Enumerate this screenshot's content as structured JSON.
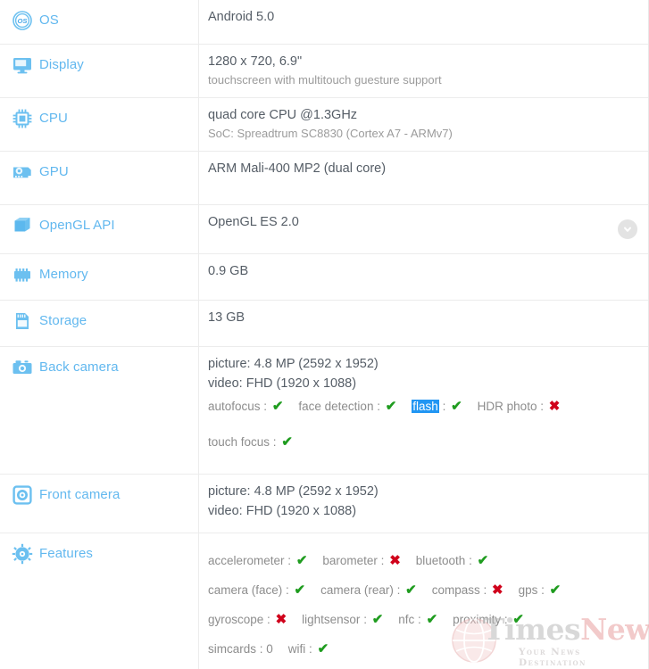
{
  "accent_color": "#62b8ef",
  "yes_color": "#1f9c1f",
  "no_color": "#d0021b",
  "highlight_color": "#2196f3",
  "symbols": {
    "yes": "✔",
    "no": "✖"
  },
  "rows": [
    {
      "key": "os",
      "icon": "os-icon",
      "label": "OS",
      "primary": "Android 5.0",
      "secondary": ""
    },
    {
      "key": "display",
      "icon": "display-icon",
      "label": "Display",
      "primary": "1280 x 720, 6.9\"",
      "secondary": "touchscreen with multitouch guesture support"
    },
    {
      "key": "cpu",
      "icon": "cpu-icon",
      "label": "CPU",
      "primary": "quad core CPU @1.3GHz",
      "secondary": "SoC: Spreadtrum SC8830 (Cortex A7 - ARMv7)"
    },
    {
      "key": "gpu",
      "icon": "gpu-icon",
      "label": "GPU",
      "primary": "ARM Mali-400 MP2 (dual core)",
      "secondary": ""
    },
    {
      "key": "opengl",
      "icon": "opengl-icon",
      "label": "OpenGL API",
      "primary": "OpenGL ES 2.0",
      "secondary": "",
      "expandable": true
    },
    {
      "key": "memory",
      "icon": "memory-icon",
      "label": "Memory",
      "primary": "0.9 GB",
      "secondary": ""
    },
    {
      "key": "storage",
      "icon": "storage-icon",
      "label": "Storage",
      "primary": "13 GB",
      "secondary": ""
    }
  ],
  "back_camera": {
    "icon": "back-camera-icon",
    "label": "Back camera",
    "picture": "picture: 4.8 MP (2592 x 1952)",
    "video": "video: FHD (1920 x 1088)",
    "features_line1": [
      {
        "name": "autofocus",
        "value": "yes",
        "highlighted": false
      },
      {
        "name": "face detection",
        "value": "yes",
        "highlighted": false
      },
      {
        "name": "flash",
        "value": "yes",
        "highlighted": true
      },
      {
        "name": "HDR photo",
        "value": "no",
        "highlighted": false
      }
    ],
    "features_line2": [
      {
        "name": "touch focus",
        "value": "yes",
        "highlighted": false
      }
    ]
  },
  "front_camera": {
    "icon": "front-camera-icon",
    "label": "Front camera",
    "picture": "picture: 4.8 MP (2592 x 1952)",
    "video": "video: FHD (1920 x 1088)"
  },
  "features": {
    "icon": "features-icon",
    "label": "Features",
    "lines": [
      [
        {
          "name": "accelerometer",
          "value": "yes"
        },
        {
          "name": "barometer",
          "value": "no"
        },
        {
          "name": "bluetooth",
          "value": "yes"
        }
      ],
      [
        {
          "name": "camera (face)",
          "value": "yes"
        },
        {
          "name": "camera (rear)",
          "value": "yes"
        },
        {
          "name": "compass",
          "value": "no"
        },
        {
          "name": "gps",
          "value": "yes"
        }
      ],
      [
        {
          "name": "gyroscope",
          "value": "no"
        },
        {
          "name": "lightsensor",
          "value": "yes"
        },
        {
          "name": "nfc",
          "value": "yes"
        },
        {
          "name": "proximity",
          "value": "yes"
        }
      ],
      [
        {
          "name": "simcards",
          "value": "0"
        },
        {
          "name": "wifi",
          "value": "yes"
        }
      ]
    ]
  },
  "watermark": {
    "brand_first": "Times",
    "brand_second": "News",
    "tagline": "Your News Destination"
  }
}
